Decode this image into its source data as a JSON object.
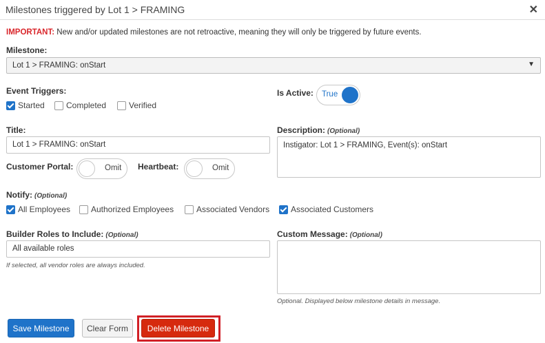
{
  "dialog": {
    "title": "Milestones triggered by Lot 1 > FRAMING",
    "close": "✕"
  },
  "notice": {
    "important": "IMPORTANT:",
    "text": " New and/or updated milestones are not retroactive, meaning they will only be triggered by future events."
  },
  "milestone": {
    "label": "Milestone:",
    "value": "Lot 1 > FRAMING: onStart",
    "arrow": "▼"
  },
  "event_triggers": {
    "label": "Event Triggers:",
    "options": [
      {
        "label": "Started",
        "checked": true
      },
      {
        "label": "Completed",
        "checked": false
      },
      {
        "label": "Verified",
        "checked": false
      }
    ]
  },
  "is_active": {
    "label": "Is Active:",
    "value": "True",
    "on": true
  },
  "title_field": {
    "label": "Title:",
    "value": "Lot 1 > FRAMING: onStart"
  },
  "description": {
    "label": "Description:",
    "optional": "(Optional)",
    "value": "Instigator: Lot 1 > FRAMING, Event(s): onStart"
  },
  "customer_portal": {
    "label": "Customer Portal:",
    "value": "Omit",
    "on": false
  },
  "heartbeat": {
    "label": "Heartbeat:",
    "value": "Omit",
    "on": false
  },
  "notify": {
    "label": "Notify:",
    "optional": "(Optional)",
    "options": [
      {
        "label": "All Employees",
        "checked": true
      },
      {
        "label": "Authorized Employees",
        "checked": false
      },
      {
        "label": "Associated Vendors",
        "checked": false
      },
      {
        "label": "Associated Customers",
        "checked": true
      }
    ]
  },
  "builder_roles": {
    "label": "Builder Roles to Include:",
    "optional": "(Optional)",
    "value": "All available roles",
    "hint": "If selected, all vendor roles are always included."
  },
  "custom_message": {
    "label": "Custom Message:",
    "optional": "(Optional)",
    "value": "",
    "hint": "Optional. Displayed below milestone details in message."
  },
  "buttons": {
    "save": "Save Milestone",
    "clear": "Clear Form",
    "delete": "Delete Milestone"
  },
  "colors": {
    "accent": "#1f73c9",
    "danger": "#d62a0e",
    "important": "#d9262b"
  }
}
